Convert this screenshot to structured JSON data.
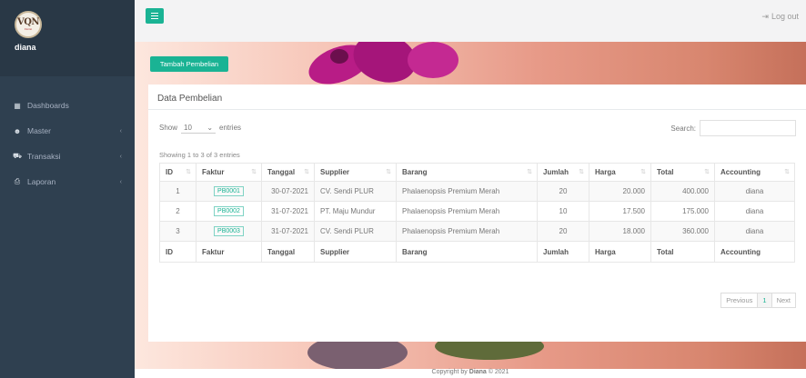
{
  "sidebar": {
    "logo_text": "VQN",
    "logo_sub": "Florist",
    "username": "diana",
    "items": [
      {
        "label": "Dashboards",
        "icon": "grid-icon",
        "has_submenu": false
      },
      {
        "label": "Master",
        "icon": "users-icon",
        "has_submenu": true
      },
      {
        "label": "Transaksi",
        "icon": "cart-icon",
        "has_submenu": true
      },
      {
        "label": "Laporan",
        "icon": "print-icon",
        "has_submenu": true
      }
    ]
  },
  "topbar": {
    "logout_label": "Log out"
  },
  "add_button": "Tambah Pembelian",
  "card": {
    "title": "Data Pembelian",
    "show_label": "Show",
    "entries_value": "10",
    "entries_label": "entries",
    "search_label": "Search:",
    "search_value": "",
    "info": "Showing 1 to 3 of 3 entries"
  },
  "table": {
    "columns": [
      "ID",
      "Faktur",
      "Tanggal",
      "Supplier",
      "Barang",
      "Jumlah",
      "Harga",
      "Total",
      "Accounting"
    ],
    "rows": [
      {
        "id": "1",
        "faktur": "PB0001",
        "tanggal": "30-07-2021",
        "supplier": "CV. Sendi PLUR",
        "barang": "Phalaenopsis Premium Merah",
        "jumlah": "20",
        "harga": "20.000",
        "total": "400.000",
        "accounting": "diana"
      },
      {
        "id": "2",
        "faktur": "PB0002",
        "tanggal": "31-07-2021",
        "supplier": "PT. Maju Mundur",
        "barang": "Phalaenopsis Premium Merah",
        "jumlah": "10",
        "harga": "17.500",
        "total": "175.000",
        "accounting": "diana"
      },
      {
        "id": "3",
        "faktur": "PB0003",
        "tanggal": "31-07-2021",
        "supplier": "CV. Sendi PLUR",
        "barang": "Phalaenopsis Premium Merah",
        "jumlah": "20",
        "harga": "18.000",
        "total": "360.000",
        "accounting": "diana"
      }
    ]
  },
  "pagination": {
    "previous": "Previous",
    "current": "1",
    "next": "Next"
  },
  "footer": {
    "prefix": "Copyright by",
    "name": "Diana",
    "suffix": "© 2021"
  },
  "colors": {
    "accent": "#1ab394",
    "sidebar": "#2f4050"
  }
}
